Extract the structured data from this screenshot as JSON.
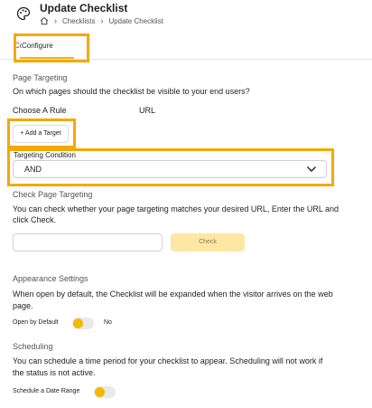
{
  "header": {
    "title": "Update Checklist",
    "breadcrumb": [
      "Checklists",
      "Update Checklist"
    ],
    "home_icon": "home-icon",
    "app_icon": "palette-icon"
  },
  "tabs": [
    {
      "label": "Content",
      "active": false
    },
    {
      "label": "Configure",
      "active": true
    }
  ],
  "page_targeting": {
    "title": "Page Targeting",
    "description": "On which pages should the checklist be visible to your end users?",
    "rule_label": "Choose A Rule",
    "rule_value": "URL",
    "add_target_label": "+ Add a Target",
    "condition_label": "Targeting Condition",
    "condition_value": "AND"
  },
  "check_targeting": {
    "title": "Check Page Targeting",
    "description_line1": "You can check whether your page targeting matches your desired URL, Enter the URL and",
    "description_line2": "click Check.",
    "url_value": "",
    "check_label": "Check"
  },
  "appearance": {
    "title": "Appearance Settings",
    "description_line1": "When open by default, the Checklist will be expanded when the visitor arrives on the web",
    "description_line2": "page.",
    "open_label": "Open by Default",
    "open_state": "No"
  },
  "scheduling": {
    "title": "Scheduling",
    "description_line1": "You can schedule a time period for your checklist to appear. Scheduling will not work if",
    "description_line2": "the status is not active.",
    "schedule_label": "Schedule a Date Range"
  },
  "colors": {
    "accent": "#f5b800",
    "highlight": "#f5a800",
    "check_button": "#fde7a3"
  }
}
